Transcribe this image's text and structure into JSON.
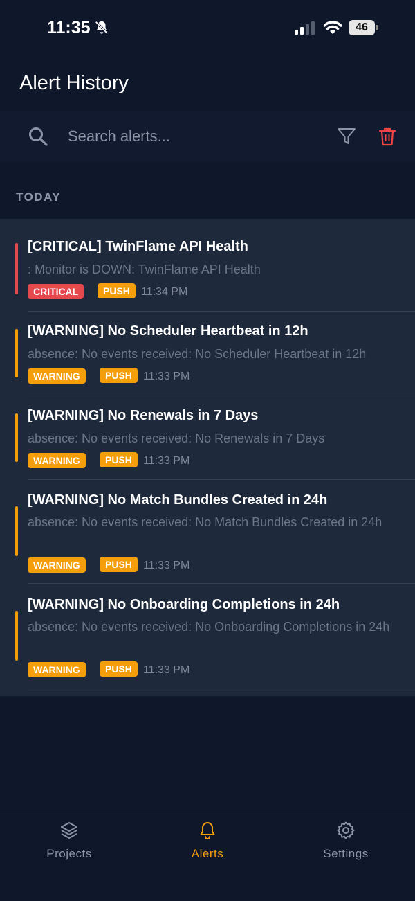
{
  "status_bar": {
    "time": "11:35",
    "battery": "46"
  },
  "header": {
    "title": "Alert History"
  },
  "search": {
    "placeholder": "Search alerts..."
  },
  "section": {
    "label": "TODAY"
  },
  "alerts": [
    {
      "title": "[CRITICAL] TwinFlame API Health",
      "message": ": Monitor is DOWN: TwinFlame API Health",
      "severity": "CRITICAL",
      "channel": "PUSH",
      "time": "11:34 PM"
    },
    {
      "title": "[WARNING] No Scheduler Heartbeat in 12h",
      "message": "absence: No events received: No Scheduler Heartbeat in 12h",
      "severity": "WARNING",
      "channel": "PUSH",
      "time": "11:33 PM"
    },
    {
      "title": "[WARNING] No Renewals in 7 Days",
      "message": "absence: No events received: No Renewals in 7 Days",
      "severity": "WARNING",
      "channel": "PUSH",
      "time": "11:33 PM"
    },
    {
      "title": "[WARNING] No Match Bundles Created in 24h",
      "message": "absence: No events received: No Match Bundles Created in 24h",
      "severity": "WARNING",
      "channel": "PUSH",
      "time": "11:33 PM"
    },
    {
      "title": "[WARNING] No Onboarding Completions in 24h",
      "message": "absence: No events received: No Onboarding Completions in 24h",
      "severity": "WARNING",
      "channel": "PUSH",
      "time": "11:33 PM"
    }
  ],
  "tabs": [
    {
      "label": "Projects",
      "icon": "layers-icon",
      "active": false
    },
    {
      "label": "Alerts",
      "icon": "bell-icon",
      "active": true
    },
    {
      "label": "Settings",
      "icon": "gear-icon",
      "active": false
    }
  ],
  "colors": {
    "background": "#0f172a",
    "card": "#1e293b",
    "critical": "#e5484d",
    "warning": "#f59e0b",
    "active_tab": "#f59e0b",
    "inactive_tab": "#8b95a7",
    "trash": "#ef4444"
  }
}
